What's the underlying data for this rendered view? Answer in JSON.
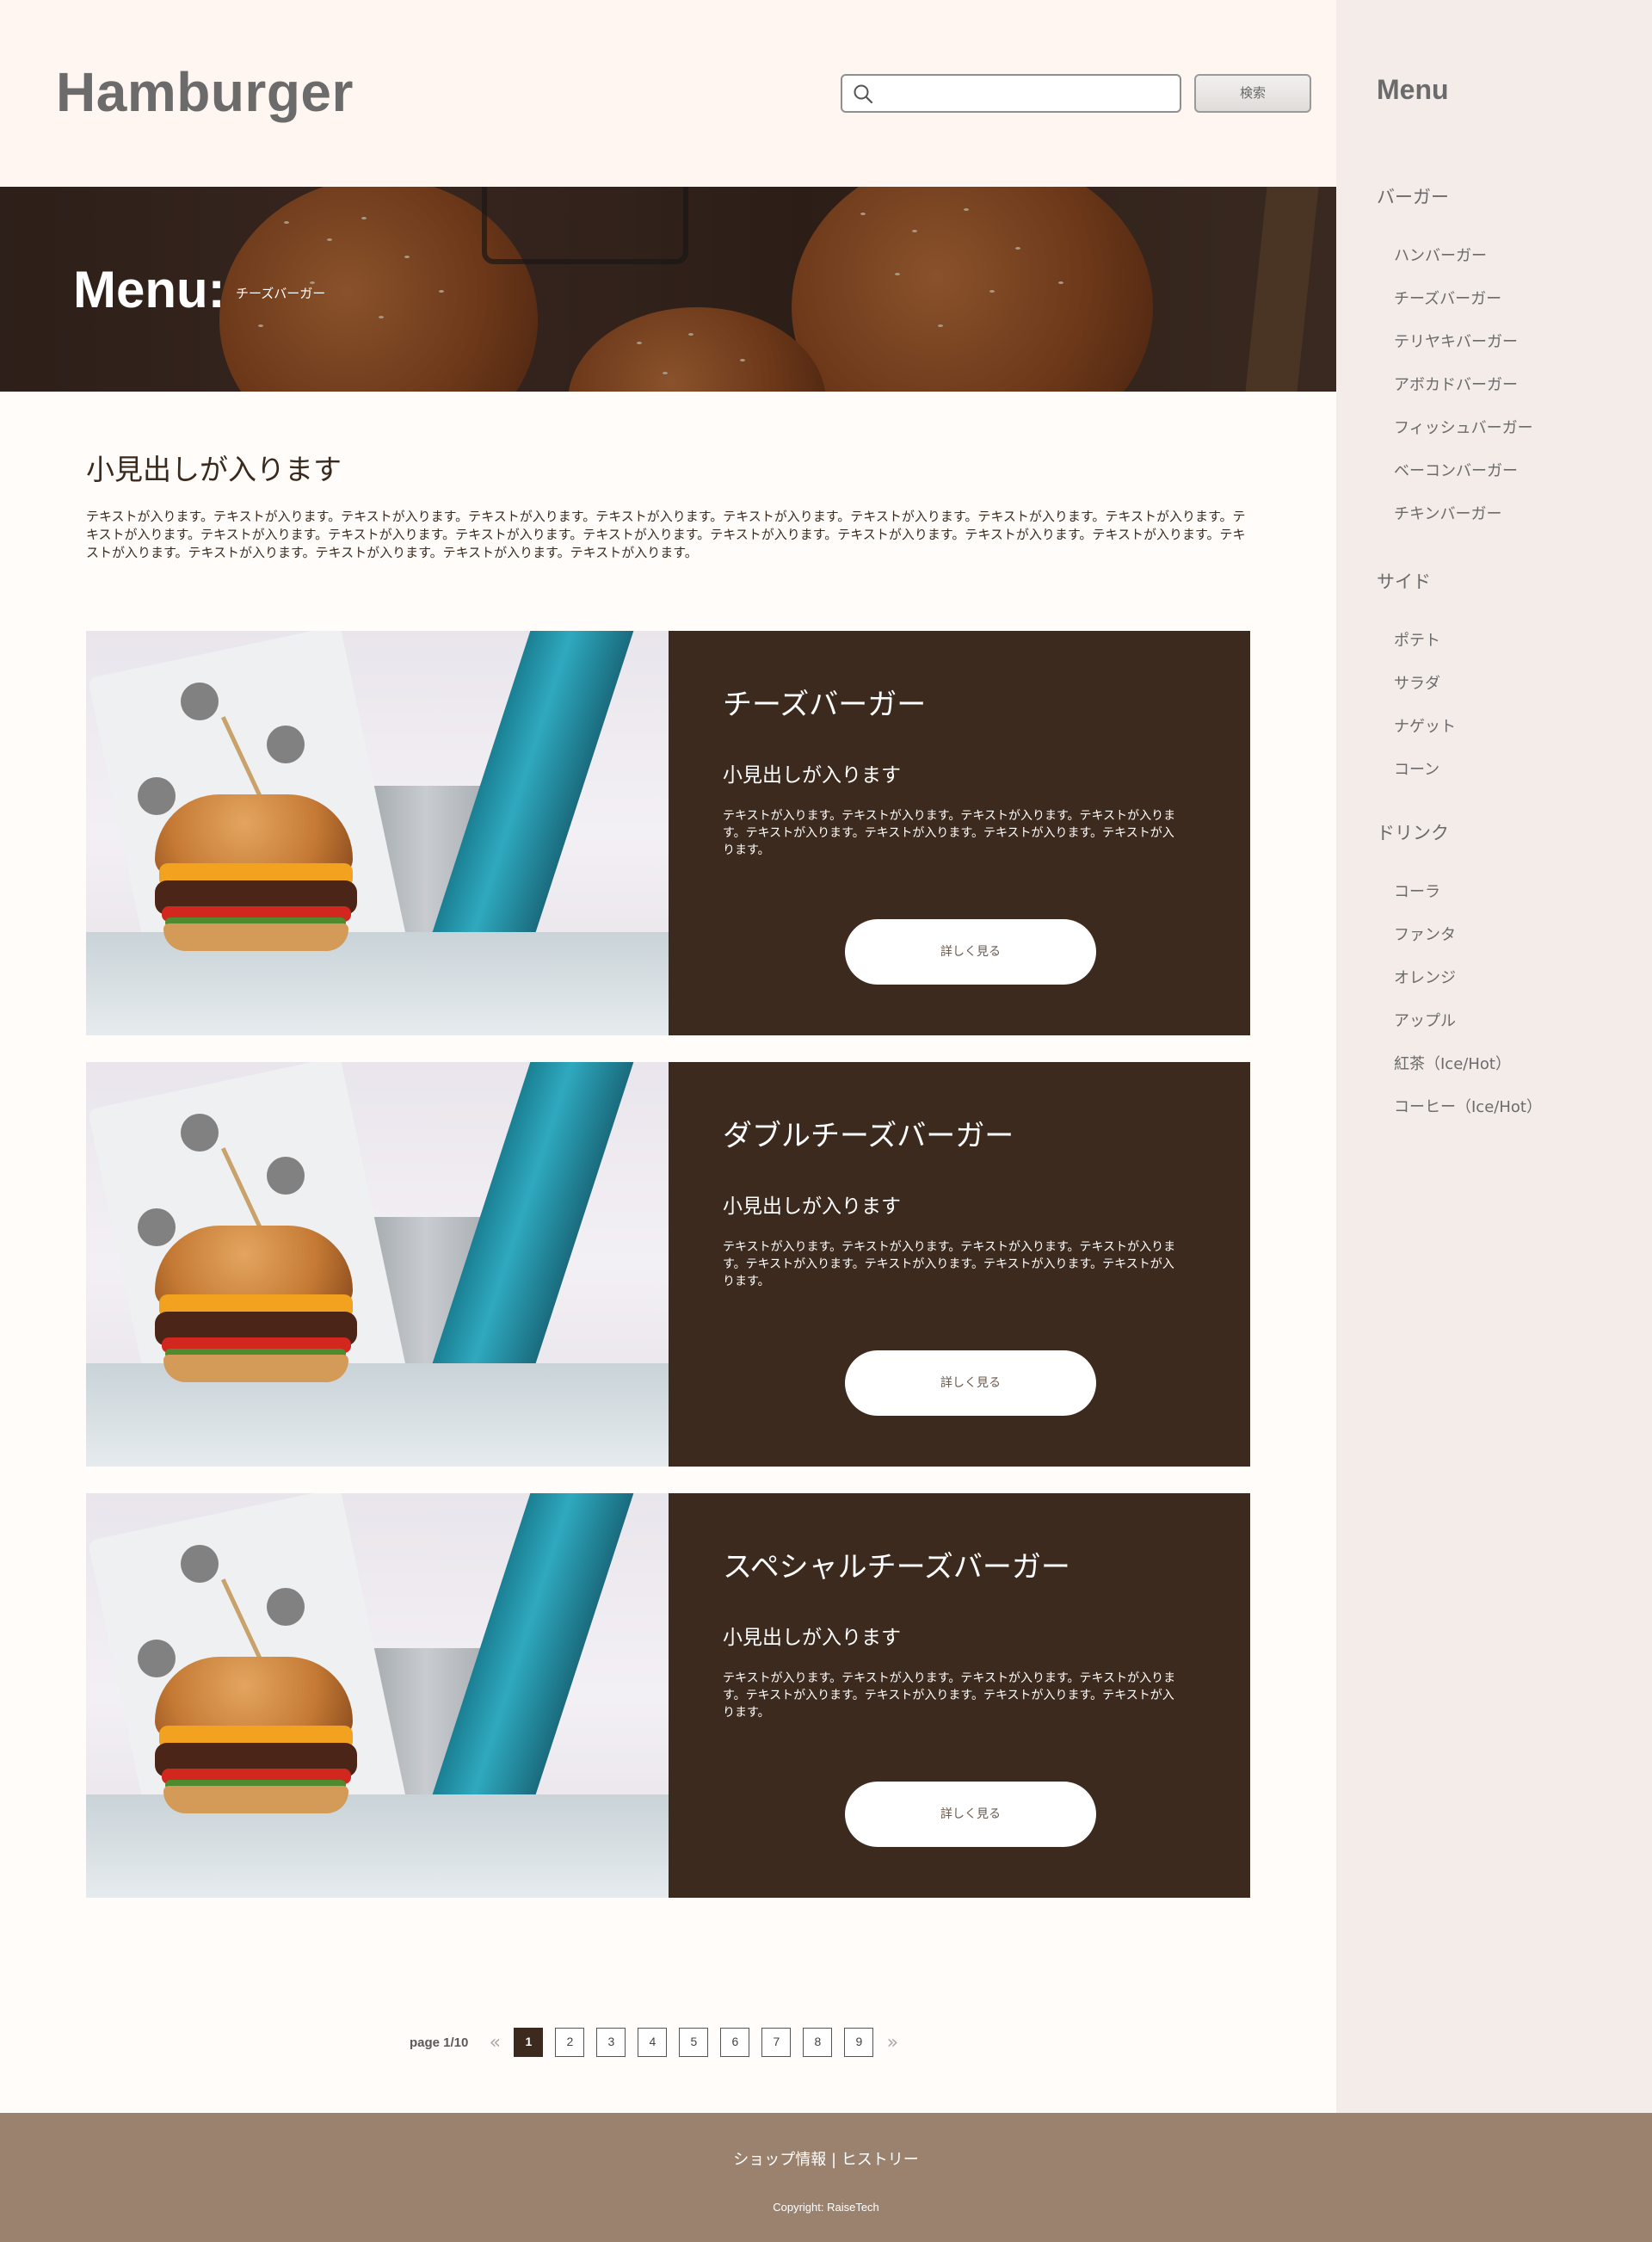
{
  "header": {
    "logo": "Hamburger",
    "search": {
      "placeholder": "",
      "value": ""
    },
    "search_button": "検索"
  },
  "hero": {
    "title": "Menu:",
    "subtitle": "チーズバーガー"
  },
  "intro": {
    "heading": "小見出しが入ります",
    "text": "テキストが入ります。テキストが入ります。テキストが入ります。テキストが入ります。テキストが入ります。テキストが入ります。テキストが入ります。テキストが入ります。テキストが入ります。テキストが入ります。テキストが入ります。テキストが入ります。テキストが入ります。テキストが入ります。テキストが入ります。テキストが入ります。テキストが入ります。テキストが入ります。テキストが入ります。テキストが入ります。テキストが入ります。テキストが入ります。テキストが入ります。"
  },
  "cards": [
    {
      "title": "チーズバーガー",
      "subheading": "小見出しが入ります",
      "text": "テキストが入ります。テキストが入ります。テキストが入ります。テキストが入ります。テキストが入ります。テキストが入ります。テキストが入ります。テキストが入ります。",
      "button": "詳しく見る"
    },
    {
      "title": "ダブルチーズバーガー",
      "subheading": "小見出しが入ります",
      "text": "テキストが入ります。テキストが入ります。テキストが入ります。テキストが入ります。テキストが入ります。テキストが入ります。テキストが入ります。テキストが入ります。",
      "button": "詳しく見る"
    },
    {
      "title": "スペシャルチーズバーガー",
      "subheading": "小見出しが入ります",
      "text": "テキストが入ります。テキストが入ります。テキストが入ります。テキストが入ります。テキストが入ります。テキストが入ります。テキストが入ります。テキストが入ります。",
      "button": "詳しく見る"
    }
  ],
  "pagination": {
    "label": "page 1/10",
    "prev_icon": "double-chevron-left-icon",
    "next_icon": "double-chevron-right-icon",
    "prev_glyph": "«",
    "next_glyph": "»",
    "pages": [
      "1",
      "2",
      "3",
      "4",
      "5",
      "6",
      "7",
      "8",
      "9"
    ],
    "current": "1"
  },
  "sidebar": {
    "title": "Menu",
    "categories": [
      {
        "name": "バーガー",
        "items": [
          "ハンバーガー",
          "チーズバーガー",
          "テリヤキバーガー",
          "アボカドバーガー",
          "フィッシュバーガー",
          "ベーコンバーガー",
          "チキンバーガー"
        ]
      },
      {
        "name": "サイド",
        "items": [
          "ポテト",
          "サラダ",
          "ナゲット",
          "コーン"
        ]
      },
      {
        "name": "ドリンク",
        "items": [
          "コーラ",
          "ファンタ",
          "オレンジ",
          "アップル",
          "紅茶（Ice/Hot）",
          "コーヒー（Ice/Hot）"
        ]
      }
    ]
  },
  "footer": {
    "links": "ショップ情報 | ヒストリー",
    "copyright": "Copyright: RaiseTech"
  },
  "colors": {
    "accent_dark": "#3d2a1e",
    "footer": "#9b826e",
    "sidebar_bg": "#f3ece8",
    "header_bg": "#fff6f1"
  }
}
